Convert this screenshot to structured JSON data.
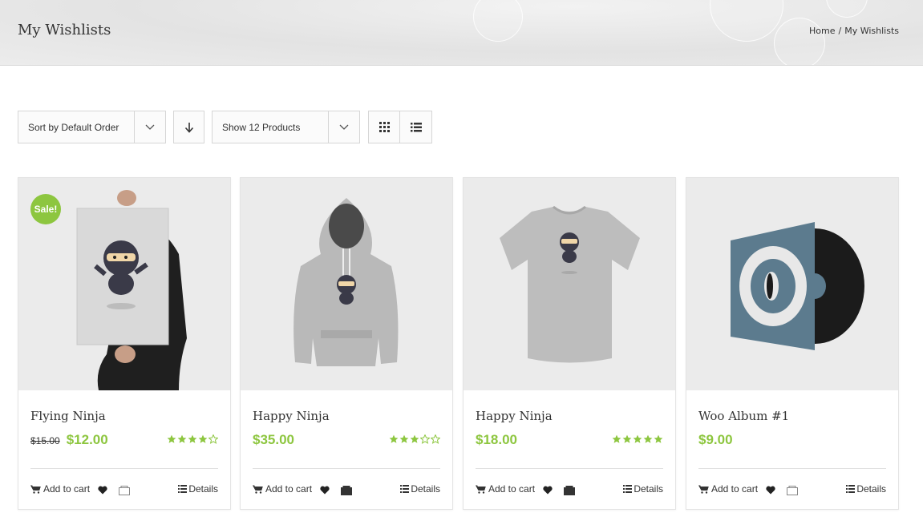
{
  "header": {
    "title": "My Wishlists",
    "breadcrumb": {
      "home": "Home",
      "separator": "/",
      "current": "My Wishlists"
    }
  },
  "toolbar": {
    "sort_label": "Sort by Default Order",
    "count_label": "Show 12 Products"
  },
  "colors": {
    "accent": "#8dc63f",
    "text": "#333333",
    "border": "#d6d6d6"
  },
  "products": [
    {
      "name": "Flying Ninja",
      "old_price": "$15.00",
      "price": "$12.00",
      "rating": 4,
      "badge": "Sale!",
      "cart": "Add to cart",
      "details": "Details",
      "image": "poster-ninja",
      "compare_filled": false
    },
    {
      "name": "Happy Ninja",
      "old_price": "",
      "price": "$35.00",
      "rating": 3,
      "badge": "",
      "cart": "Add to cart",
      "details": "Details",
      "image": "hoodie-ninja",
      "compare_filled": true
    },
    {
      "name": "Happy Ninja",
      "old_price": "",
      "price": "$18.00",
      "rating": 5,
      "badge": "",
      "cart": "Add to cart",
      "details": "Details",
      "image": "tshirt-ninja",
      "compare_filled": true
    },
    {
      "name": "Woo Album #1",
      "old_price": "",
      "price": "$9.00",
      "rating": 0,
      "badge": "",
      "cart": "Add to cart",
      "details": "Details",
      "image": "album-vinyl",
      "compare_filled": false
    }
  ]
}
